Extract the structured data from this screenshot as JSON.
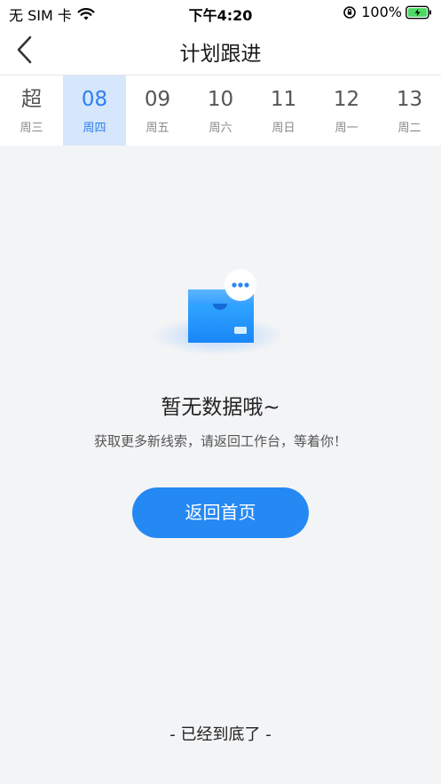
{
  "status_bar": {
    "carrier": "无 SIM 卡",
    "time": "下午4:20",
    "battery": "100%"
  },
  "nav": {
    "title": "计划跟进"
  },
  "dates": [
    {
      "num": "超",
      "weekday": "周三",
      "selected": false
    },
    {
      "num": "08",
      "weekday": "周四",
      "selected": true
    },
    {
      "num": "09",
      "weekday": "周五",
      "selected": false
    },
    {
      "num": "10",
      "weekday": "周六",
      "selected": false
    },
    {
      "num": "11",
      "weekday": "周日",
      "selected": false
    },
    {
      "num": "12",
      "weekday": "周一",
      "selected": false
    },
    {
      "num": "13",
      "weekday": "周二",
      "selected": false
    }
  ],
  "empty": {
    "title": "暂无数据哦~",
    "description": "获取更多新线索，请返回工作台，等着你！",
    "button_label": "返回首页",
    "icon": "empty-box-icon"
  },
  "footer": {
    "note": "- 已经到底了 -"
  },
  "colors": {
    "accent": "#2589f4",
    "selected_bg": "#d6e6fb",
    "page_bg": "#f3f4f6"
  }
}
